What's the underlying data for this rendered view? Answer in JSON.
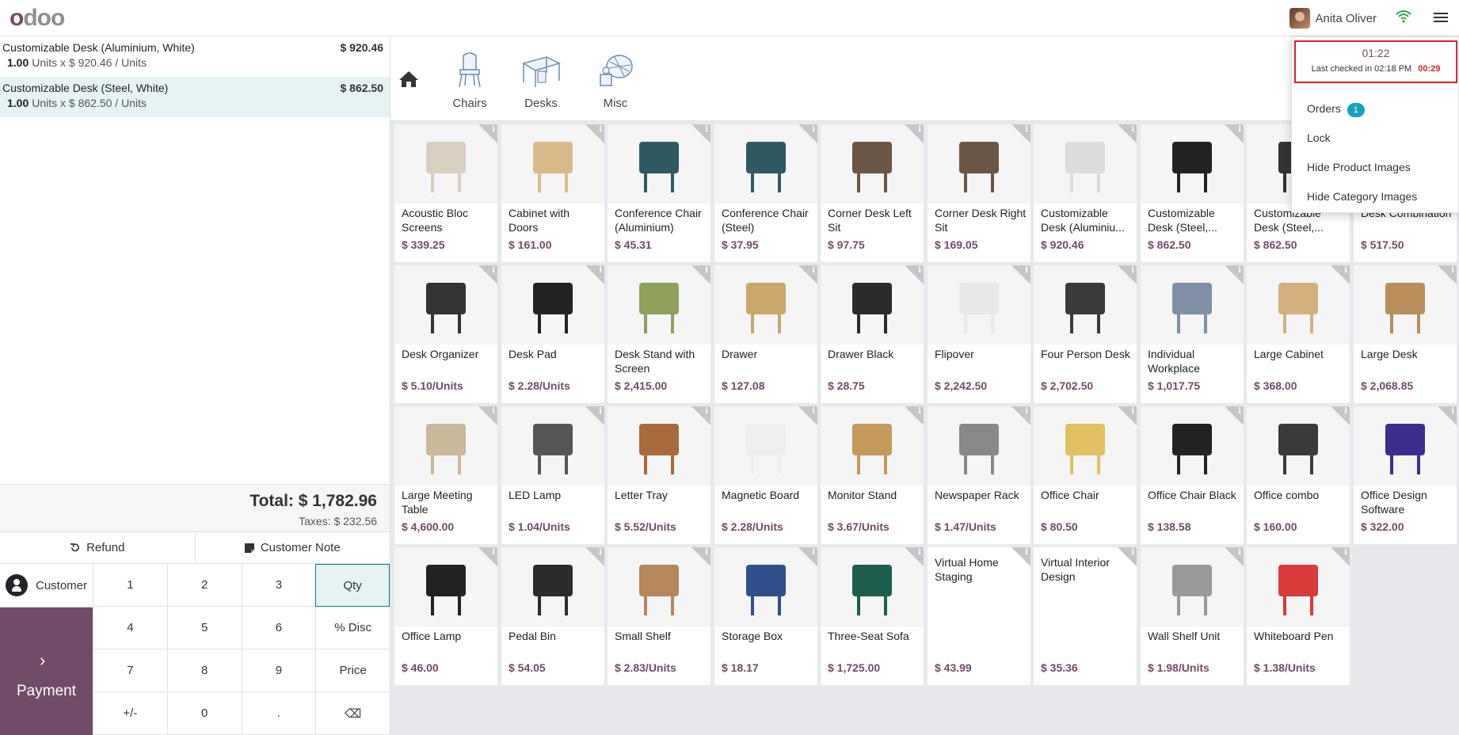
{
  "navbar": {
    "logo": "odoo",
    "user_name": "Anita Oliver"
  },
  "order": {
    "lines": [
      {
        "name": "Customizable Desk (Aluminium, White)",
        "price": "$ 920.46",
        "qty": "1.00",
        "detail": "Units x $ 920.46 / Units",
        "selected": false
      },
      {
        "name": "Customizable Desk (Steel, White)",
        "price": "$ 862.50",
        "qty": "1.00",
        "detail": "Units x $ 862.50 / Units",
        "selected": true
      }
    ],
    "total": "Total: $ 1,782.96",
    "taxes": "Taxes: $ 232.56"
  },
  "actions": {
    "refund": "Refund",
    "customer_note": "Customer Note"
  },
  "pad": {
    "customer": "Customer",
    "payment": "Payment",
    "keys": [
      "1",
      "2",
      "3",
      "Qty",
      "4",
      "5",
      "6",
      "% Disc",
      "7",
      "8",
      "9",
      "Price",
      "+/-",
      "0",
      ".",
      "⌫"
    ]
  },
  "categories": [
    {
      "label": "Chairs",
      "icon": "chair-icon"
    },
    {
      "label": "Desks",
      "icon": "desk-icon"
    },
    {
      "label": "Misc",
      "icon": "misc-icon"
    }
  ],
  "products": [
    {
      "name": "Acoustic Bloc Screens",
      "price": "$ 339.25",
      "color": "#d8cfc0"
    },
    {
      "name": "Cabinet with Doors",
      "price": "$ 161.00",
      "color": "#d9b98a"
    },
    {
      "name": "Conference Chair (Aluminium)",
      "price": "$ 45.31",
      "color": "#2f5a63"
    },
    {
      "name": "Conference Chair (Steel)",
      "price": "$ 37.95",
      "color": "#2f5a63"
    },
    {
      "name": "Corner Desk Left Sit",
      "price": "$ 97.75",
      "color": "#6b5544"
    },
    {
      "name": "Corner Desk Right Sit",
      "price": "$ 169.05",
      "color": "#6b5544"
    },
    {
      "name": "Customizable Desk (Aluminiu...",
      "price": "$ 920.46",
      "color": "#dcdcdc"
    },
    {
      "name": "Customizable Desk (Steel,...",
      "price": "$ 862.50",
      "color": "#222222"
    },
    {
      "name": "Customizable Desk (Steel,...",
      "price": "$ 862.50",
      "color": "#333333"
    },
    {
      "name": "Desk Combination",
      "price": "$ 517.50",
      "color": "#cfcfcf"
    },
    {
      "name": "Desk Organizer",
      "price": "$ 5.10/Units",
      "color": "#333333"
    },
    {
      "name": "Desk Pad",
      "price": "$ 2.28/Units",
      "color": "#222222"
    },
    {
      "name": "Desk Stand with Screen",
      "price": "$ 2,415.00",
      "color": "#8ea05a"
    },
    {
      "name": "Drawer",
      "price": "$ 127.08",
      "color": "#c9a66b"
    },
    {
      "name": "Drawer Black",
      "price": "$ 28.75",
      "color": "#2b2b2b"
    },
    {
      "name": "Flipover",
      "price": "$ 2,242.50",
      "color": "#e9e9e9"
    },
    {
      "name": "Four Person Desk",
      "price": "$ 2,702.50",
      "color": "#3a3a3a"
    },
    {
      "name": "Individual Workplace",
      "price": "$ 1,017.75",
      "color": "#7f8fa6"
    },
    {
      "name": "Large Cabinet",
      "price": "$ 368.00",
      "color": "#d4b07e"
    },
    {
      "name": "Large Desk",
      "price": "$ 2,068.85",
      "color": "#b98e5b"
    },
    {
      "name": "Large Meeting Table",
      "price": "$ 4,600.00",
      "color": "#c9b89a"
    },
    {
      "name": "LED Lamp",
      "price": "$ 1.04/Units",
      "color": "#555555"
    },
    {
      "name": "Letter Tray",
      "price": "$ 5.52/Units",
      "color": "#a86a3c"
    },
    {
      "name": "Magnetic Board",
      "price": "$ 2.28/Units",
      "color": "#eeeeee"
    },
    {
      "name": "Monitor Stand",
      "price": "$ 3.67/Units",
      "color": "#c49a5a"
    },
    {
      "name": "Newspaper Rack",
      "price": "$ 1.47/Units",
      "color": "#888888"
    },
    {
      "name": "Office Chair",
      "price": "$ 80.50",
      "color": "#e0c060"
    },
    {
      "name": "Office Chair Black",
      "price": "$ 138.58",
      "color": "#222222"
    },
    {
      "name": "Office combo",
      "price": "$ 160.00",
      "color": "#3a3a3a"
    },
    {
      "name": "Office Design Software",
      "price": "$ 322.00",
      "color": "#3b2e8f"
    },
    {
      "name": "Office Lamp",
      "price": "$ 46.00",
      "color": "#222222"
    },
    {
      "name": "Pedal Bin",
      "price": "$ 54.05",
      "color": "#2b2b2b"
    },
    {
      "name": "Small Shelf",
      "price": "$ 2.83/Units",
      "color": "#b6875a"
    },
    {
      "name": "Storage Box",
      "price": "$ 18.17",
      "color": "#2e4f8c"
    },
    {
      "name": "Three-Seat Sofa",
      "price": "$ 1,725.00",
      "color": "#1d5e4f"
    },
    {
      "name": "Virtual Home Staging",
      "price": "$ 43.99",
      "color": ""
    },
    {
      "name": "Virtual Interior Design",
      "price": "$ 35.36",
      "color": ""
    },
    {
      "name": "Wall Shelf Unit",
      "price": "$ 1.98/Units",
      "color": "#9a9a9a"
    },
    {
      "name": "Whiteboard Pen",
      "price": "$ 1.38/Units",
      "color": "#d93a3a"
    }
  ],
  "menu": {
    "timer": "01:22",
    "last_checked": "Last checked in 02:18 PM",
    "last_checked_time": "00:29",
    "orders": "Orders",
    "orders_count": "1",
    "lock": "Lock",
    "hide_product_images": "Hide Product Images",
    "hide_category_images": "Hide Category Images"
  },
  "colors": {
    "brand": "#714B67",
    "accent": "#017e84",
    "badge": "#17a2b8",
    "alert": "#d9242b"
  }
}
